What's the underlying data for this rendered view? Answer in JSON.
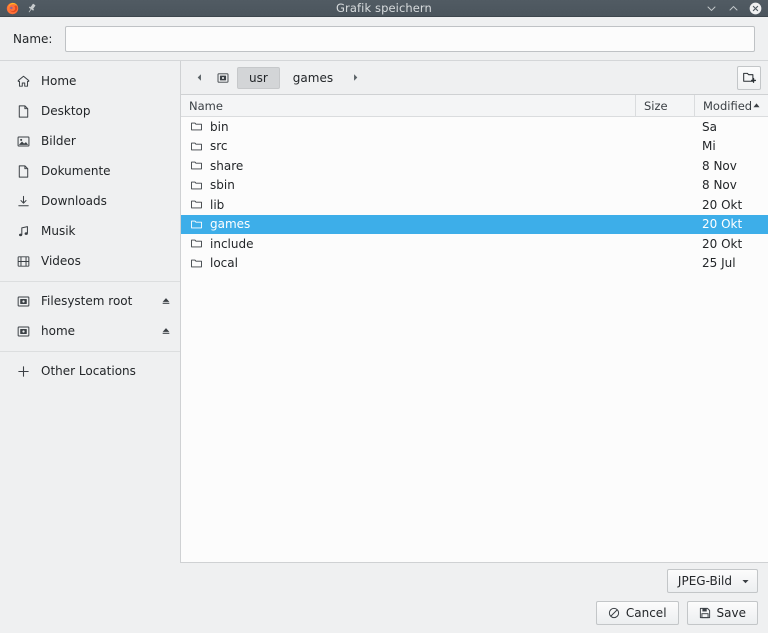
{
  "window": {
    "title": "Grafik speichern",
    "app_icon": "firefox-icon",
    "pin_icon": "pin-icon",
    "minimize_icon": "chevron-down-icon",
    "maximize_icon": "chevron-up-icon",
    "close_icon": "close-icon"
  },
  "name_field": {
    "label": "Name:",
    "value": "",
    "placeholder": ""
  },
  "sidebar": {
    "items": [
      {
        "label": "Home",
        "icon": "home-icon",
        "eject": false
      },
      {
        "label": "Desktop",
        "icon": "document-icon",
        "eject": false
      },
      {
        "label": "Bilder",
        "icon": "image-icon",
        "eject": false
      },
      {
        "label": "Dokumente",
        "icon": "document-icon",
        "eject": false
      },
      {
        "label": "Downloads",
        "icon": "download-icon",
        "eject": false
      },
      {
        "label": "Musik",
        "icon": "music-note-icon",
        "eject": false
      },
      {
        "label": "Videos",
        "icon": "film-icon",
        "eject": false
      }
    ],
    "devices": [
      {
        "label": "Filesystem root",
        "icon": "harddisk-icon",
        "eject": true,
        "eject_icon": "eject-icon"
      },
      {
        "label": "home",
        "icon": "harddisk-icon",
        "eject": true,
        "eject_icon": "eject-icon"
      }
    ],
    "other": {
      "label": "Other Locations",
      "icon": "plus-icon"
    }
  },
  "pathbar": {
    "back_icon": "triangle-left-icon",
    "forward_icon": "triangle-right-icon",
    "drive_icon": "harddisk-icon",
    "crumbs": [
      {
        "label": "usr",
        "active": true
      },
      {
        "label": "games",
        "active": false
      }
    ],
    "new_folder_icon": "new-folder-icon"
  },
  "filelist": {
    "columns": {
      "name": "Name",
      "size": "Size",
      "modified": "Modified",
      "sort_icon": "sort-ascending-icon"
    },
    "rows": [
      {
        "name": "bin",
        "size": "",
        "modified": "Sa",
        "selected": false,
        "icon": "folder-icon"
      },
      {
        "name": "src",
        "size": "",
        "modified": "Mi",
        "selected": false,
        "icon": "folder-icon"
      },
      {
        "name": "share",
        "size": "",
        "modified": "8 Nov",
        "selected": false,
        "icon": "folder-icon"
      },
      {
        "name": "sbin",
        "size": "",
        "modified": "8 Nov",
        "selected": false,
        "icon": "folder-icon"
      },
      {
        "name": "lib",
        "size": "",
        "modified": "20 Okt",
        "selected": false,
        "icon": "folder-icon"
      },
      {
        "name": "games",
        "size": "",
        "modified": "20 Okt",
        "selected": true,
        "icon": "folder-icon"
      },
      {
        "name": "include",
        "size": "",
        "modified": "20 Okt",
        "selected": false,
        "icon": "folder-icon"
      },
      {
        "name": "local",
        "size": "",
        "modified": "25 Jul",
        "selected": false,
        "icon": "folder-icon"
      }
    ]
  },
  "footer": {
    "filetype": {
      "value": "JPEG-Bild",
      "chevron_icon": "chevron-down-icon"
    },
    "cancel": {
      "label": "Cancel",
      "icon": "no-entry-icon"
    },
    "save": {
      "label": "Save",
      "icon": "floppy-disk-icon"
    }
  },
  "colors": {
    "titlebar": "#4d575f",
    "selection": "#3daee9",
    "sidebar_bg": "#eff0f1",
    "list_bg": "#fcfcfc",
    "text": "#232629"
  }
}
